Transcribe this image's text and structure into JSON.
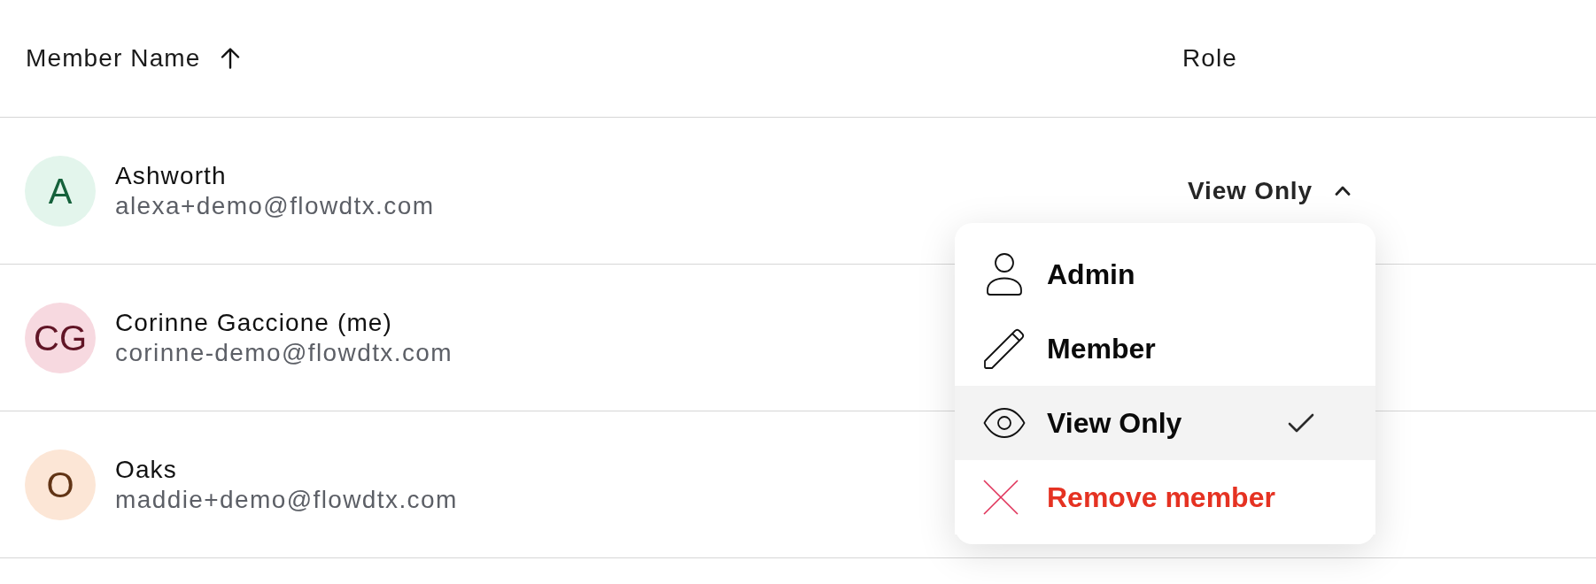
{
  "table": {
    "columns": [
      {
        "label": "Member Name",
        "sorted_ascending": true
      },
      {
        "label": "Role"
      }
    ],
    "rows": [
      {
        "initials": "A",
        "name": "Ashworth",
        "email": "alexa+demo@flowdtx.com",
        "color": "#e3f5ec",
        "role": "View Only",
        "expanded": true
      },
      {
        "initials": "CG",
        "name": "Corinne Gaccione (me)",
        "email": "corinne-demo@flowdtx.com",
        "color": "#f7d9e0"
      },
      {
        "initials": "O",
        "name": "Oaks",
        "email": "maddie+demo@flowdtx.com",
        "color": "#fce6d6"
      }
    ]
  },
  "role_menu": {
    "items": [
      {
        "kind": "admin",
        "label": "Admin",
        "selected": false
      },
      {
        "kind": "member",
        "label": "Member",
        "selected": false
      },
      {
        "kind": "view",
        "label": "View Only",
        "selected": true
      },
      {
        "kind": "remove",
        "label": "Remove member",
        "selected": false
      }
    ]
  }
}
